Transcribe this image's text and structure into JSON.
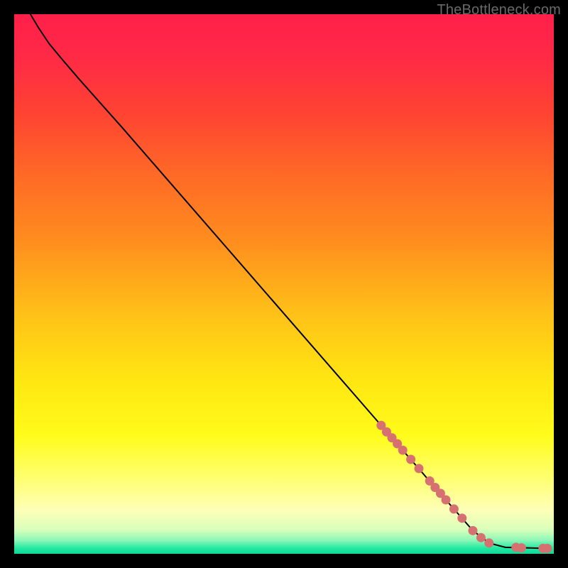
{
  "watermark": "TheBottleneck.com",
  "chart_data": {
    "type": "line",
    "title": "",
    "xlabel": "",
    "ylabel": "",
    "xlim": [
      0,
      100
    ],
    "ylim": [
      0,
      100
    ],
    "series": [
      {
        "name": "curve",
        "type": "line",
        "color": "#000000",
        "points": [
          {
            "x": 3.0,
            "y": 100.0
          },
          {
            "x": 4.5,
            "y": 97.5
          },
          {
            "x": 6.5,
            "y": 94.5
          },
          {
            "x": 9.0,
            "y": 91.5
          },
          {
            "x": 12.0,
            "y": 88.0
          },
          {
            "x": 20.0,
            "y": 79.0
          },
          {
            "x": 30.0,
            "y": 67.5
          },
          {
            "x": 40.0,
            "y": 56.0
          },
          {
            "x": 50.0,
            "y": 44.5
          },
          {
            "x": 60.0,
            "y": 33.0
          },
          {
            "x": 70.0,
            "y": 21.5
          },
          {
            "x": 80.0,
            "y": 10.0
          },
          {
            "x": 85.0,
            "y": 4.3
          },
          {
            "x": 88.0,
            "y": 2.0
          },
          {
            "x": 91.0,
            "y": 1.2
          },
          {
            "x": 95.0,
            "y": 1.1
          },
          {
            "x": 98.5,
            "y": 1.0
          }
        ]
      },
      {
        "name": "markers",
        "type": "scatter",
        "color": "#d77070",
        "points": [
          {
            "x": 68.0,
            "y": 23.8
          },
          {
            "x": 69.0,
            "y": 22.6
          },
          {
            "x": 70.0,
            "y": 21.5
          },
          {
            "x": 71.0,
            "y": 20.4
          },
          {
            "x": 72.0,
            "y": 19.2
          },
          {
            "x": 73.5,
            "y": 17.5
          },
          {
            "x": 75.0,
            "y": 15.8
          },
          {
            "x": 77.0,
            "y": 13.5
          },
          {
            "x": 78.0,
            "y": 12.3
          },
          {
            "x": 79.0,
            "y": 11.2
          },
          {
            "x": 80.0,
            "y": 10.0
          },
          {
            "x": 81.5,
            "y": 8.3
          },
          {
            "x": 83.0,
            "y": 6.6
          },
          {
            "x": 85.0,
            "y": 4.3
          },
          {
            "x": 86.5,
            "y": 3.0
          },
          {
            "x": 88.0,
            "y": 2.0
          },
          {
            "x": 93.0,
            "y": 1.2
          },
          {
            "x": 94.0,
            "y": 1.1
          },
          {
            "x": 98.0,
            "y": 1.0
          },
          {
            "x": 98.8,
            "y": 1.0
          }
        ]
      }
    ],
    "background_gradient": {
      "type": "vertical",
      "stops": [
        {
          "offset": 0.0,
          "color": "#ff1f4a"
        },
        {
          "offset": 0.08,
          "color": "#ff2a46"
        },
        {
          "offset": 0.18,
          "color": "#ff4233"
        },
        {
          "offset": 0.3,
          "color": "#ff6a26"
        },
        {
          "offset": 0.42,
          "color": "#ff8d1e"
        },
        {
          "offset": 0.55,
          "color": "#ffbf18"
        },
        {
          "offset": 0.68,
          "color": "#ffe712"
        },
        {
          "offset": 0.78,
          "color": "#fffb1a"
        },
        {
          "offset": 0.86,
          "color": "#ffff70"
        },
        {
          "offset": 0.92,
          "color": "#fdffb8"
        },
        {
          "offset": 0.955,
          "color": "#d9ffba"
        },
        {
          "offset": 0.975,
          "color": "#8cf7b8"
        },
        {
          "offset": 0.99,
          "color": "#1ee8a0"
        },
        {
          "offset": 1.0,
          "color": "#0fd897"
        }
      ]
    }
  }
}
